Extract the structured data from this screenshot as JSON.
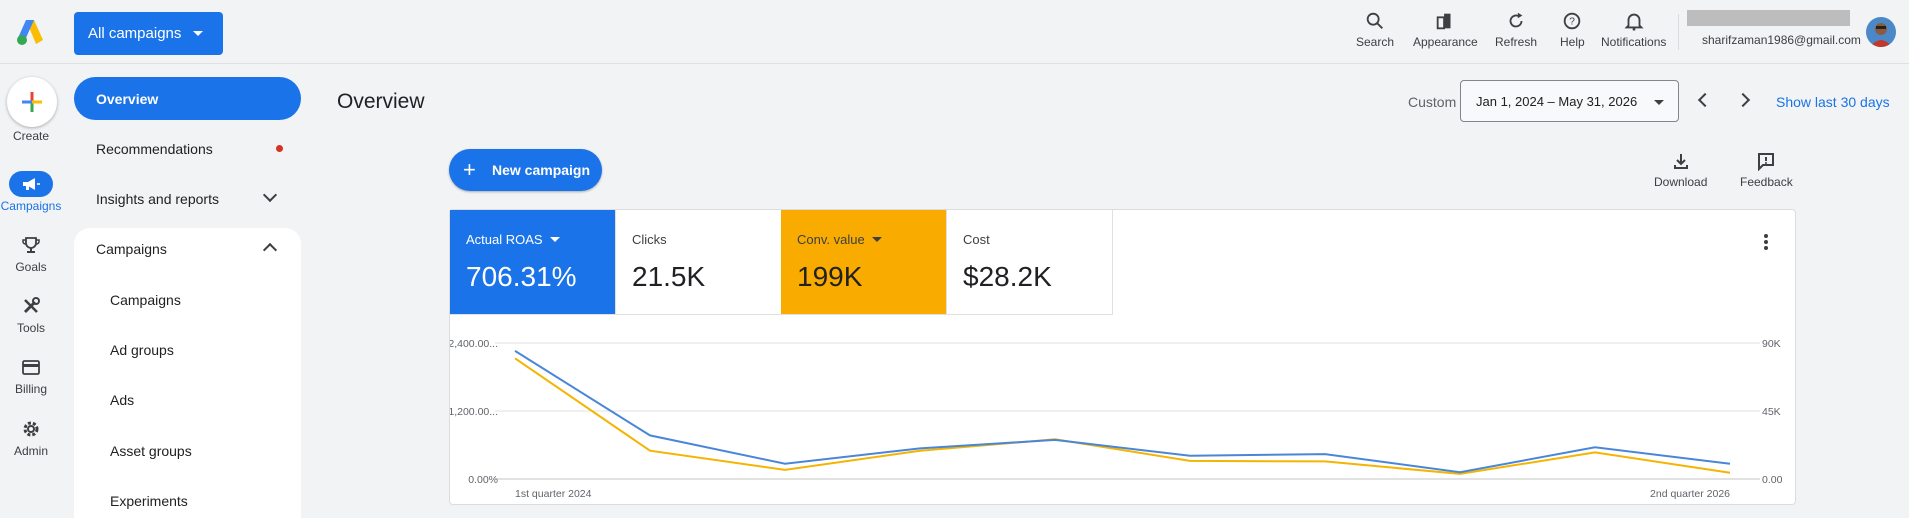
{
  "topbar": {
    "scope_button": "All campaigns",
    "tools": [
      {
        "label": "Search",
        "icon": "search-icon"
      },
      {
        "label": "Appearance",
        "icon": "appearance-icon"
      },
      {
        "label": "Refresh",
        "icon": "refresh-icon"
      },
      {
        "label": "Help",
        "icon": "help-icon"
      },
      {
        "label": "Notifications",
        "icon": "bell-icon"
      }
    ],
    "account_email": "sharifzaman1986@gmail.com"
  },
  "rail": {
    "create": "Create",
    "items": [
      {
        "label": "Campaigns",
        "icon": "megaphone-icon",
        "active": true
      },
      {
        "label": "Goals",
        "icon": "trophy-icon"
      },
      {
        "label": "Tools",
        "icon": "tools-icon"
      },
      {
        "label": "Billing",
        "icon": "credit-card-icon"
      },
      {
        "label": "Admin",
        "icon": "gear-icon"
      }
    ]
  },
  "nav": {
    "overview": "Overview",
    "recommendations": "Recommendations",
    "insights": "Insights and reports",
    "campaigns_section": "Campaigns",
    "sub_items": [
      "Campaigns",
      "Ad groups",
      "Ads",
      "Asset groups",
      "Experiments"
    ]
  },
  "header": {
    "title": "Overview",
    "custom_label": "Custom",
    "date_range": "Jan 1, 2024 – May 31, 2026",
    "show_last": "Show last 30 days"
  },
  "actions": {
    "new_campaign": "New campaign",
    "download": "Download",
    "feedback": "Feedback"
  },
  "metrics": [
    {
      "label": "Actual ROAS",
      "value": "706.31%",
      "color": "#1a73e8",
      "dropdown": true
    },
    {
      "label": "Clicks",
      "value": "21.5K",
      "color": "#ffffff",
      "dropdown": false
    },
    {
      "label": "Conv. value",
      "value": "199K",
      "color": "#f9ab00",
      "dropdown": true
    },
    {
      "label": "Cost",
      "value": "$28.2K",
      "color": "#ffffff",
      "dropdown": false
    }
  ],
  "chart_data": {
    "type": "line",
    "x_start_label": "1st quarter 2024",
    "x_end_label": "2nd quarter 2026",
    "y_left_ticks": [
      "2,400.00...",
      "1,200.00...",
      "0.00%"
    ],
    "y_right_ticks": [
      "90K",
      "45K",
      "0.00"
    ],
    "ylim_left": [
      0,
      2400
    ],
    "ylim_right": [
      0,
      90000
    ],
    "series": [
      {
        "color": "#4a86d8",
        "values": [
          2260,
          770,
          270,
          540,
          690,
          410,
          440,
          120,
          560,
          270
        ]
      },
      {
        "color": "#f4b400",
        "values": [
          2130,
          500,
          160,
          500,
          700,
          320,
          310,
          90,
          470,
          110
        ]
      }
    ]
  }
}
